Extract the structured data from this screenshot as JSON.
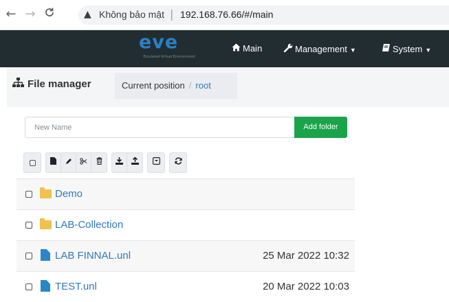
{
  "browser": {
    "back_icon": "←",
    "forward_icon": "→",
    "reload_icon": "C",
    "security_text": "Không bảo mật",
    "separator": "|",
    "url": "192.168.76.66/#/main"
  },
  "navbar": {
    "logo_text": "eve",
    "logo_subtitle": "Emulated Virtual Environment",
    "items": [
      {
        "label": "Main",
        "icon": "home-icon",
        "has_caret": false
      },
      {
        "label": "Management",
        "icon": "wrench-icon",
        "has_caret": true
      },
      {
        "label": "System",
        "icon": "book-icon",
        "has_caret": true
      }
    ],
    "background": "#222d32"
  },
  "file_manager": {
    "title": "File manager",
    "breadcrumb": {
      "label": "Current position",
      "separator": "/",
      "current": "root"
    },
    "new_name": {
      "value": "",
      "placeholder": "New Name"
    },
    "add_folder_label": "Add folder",
    "add_folder_color": "#1aa34a",
    "toolbar_icons": [
      "select-all-checkbox",
      "new-file-icon",
      "rename-icon",
      "cut-icon",
      "delete-icon",
      "import-icon",
      "export-icon",
      "archive-icon",
      "refresh-icon"
    ],
    "rows": [
      {
        "name": "Demo",
        "type": "folder",
        "date": ""
      },
      {
        "name": "LAB-Collection",
        "type": "folder",
        "date": ""
      },
      {
        "name": "LAB FINNAL.unl",
        "type": "file",
        "date": "25 Mar 2022 10:32"
      },
      {
        "name": "TEST.unl",
        "type": "file",
        "date": "20 Mar 2022 10:03"
      }
    ],
    "link_color": "#2e79c0",
    "folder_color": "#f0c24b",
    "file_color": "#2b86c8"
  }
}
